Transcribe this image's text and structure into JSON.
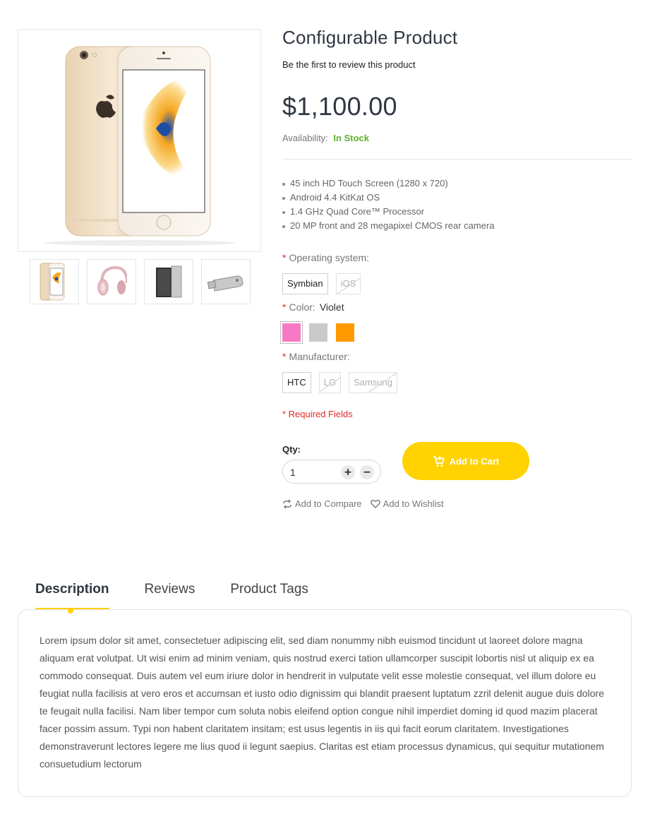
{
  "product": {
    "title": "Configurable Product",
    "review_link": "Be the first to review this product",
    "price": "$1,100.00",
    "availability_label": "Availability:",
    "availability_value": "In Stock",
    "features": [
      "45 inch HD Touch Screen (1280 x 720)",
      "Android 4.4 KitKat OS",
      "1.4 GHz Quad Core™ Processor",
      "20 MP front and 28 megapixel CMOS rear camera"
    ]
  },
  "gallery": {
    "thumbnails": [
      "phone-thumbnail",
      "headphones-thumbnail",
      "speaker-thumbnail",
      "usb-drive-thumbnail"
    ]
  },
  "options": {
    "required_mark": "*",
    "os": {
      "label": "Operating system:",
      "values": [
        {
          "label": "Symbian",
          "disabled": false
        },
        {
          "label": "iOS",
          "disabled": true
        }
      ]
    },
    "color": {
      "label": "Color:",
      "selected": "Violet",
      "swatches": [
        {
          "color": "#f779c5",
          "selected": true
        },
        {
          "color": "#c9c9c9",
          "selected": false
        },
        {
          "color": "#ff9900",
          "selected": false
        }
      ]
    },
    "manufacturer": {
      "label": "Manufacturer:",
      "values": [
        {
          "label": "HTC",
          "disabled": false
        },
        {
          "label": "LG",
          "disabled": true
        },
        {
          "label": "Samsung",
          "disabled": true
        }
      ]
    },
    "required_note": "* Required Fields"
  },
  "purchase": {
    "qty_label": "Qty:",
    "qty_value": "1",
    "plus": "+",
    "minus": "−",
    "add_to_cart": "Add to Cart",
    "compare": "Add to Compare",
    "wishlist": "Add to Wishlist"
  },
  "tabs": {
    "items": [
      "Description",
      "Reviews",
      "Product Tags"
    ],
    "active": "Description",
    "description": "Lorem ipsum dolor sit amet, consectetuer adipiscing elit, sed diam nonummy nibh euismod tincidunt ut laoreet dolore magna aliquam erat volutpat. Ut wisi enim ad minim veniam, quis nostrud exerci tation ullamcorper suscipit lobortis nisl ut aliquip ex ea commodo consequat. Duis autem vel eum iriure dolor in hendrerit in vulputate velit esse molestie consequat, vel illum dolore eu feugiat nulla facilisis at vero eros et accumsan et iusto odio dignissim qui blandit praesent luptatum zzril delenit augue duis dolore te feugait nulla facilisi. Nam liber tempor cum soluta nobis eleifend option congue nihil imperdiet doming id quod mazim placerat facer possim assum. Typi non habent claritatem insitam; est usus legentis in iis qui facit eorum claritatem. Investigationes demonstraverunt lectores legere me lius quod ii legunt saepius. Claritas est etiam processus dynamicus, qui sequitur mutationem consuetudium lectorum"
  },
  "colors": {
    "accent": "#ffd200",
    "in_stock": "#5cb02c",
    "required": "#e02b27",
    "title": "#2f3742"
  }
}
